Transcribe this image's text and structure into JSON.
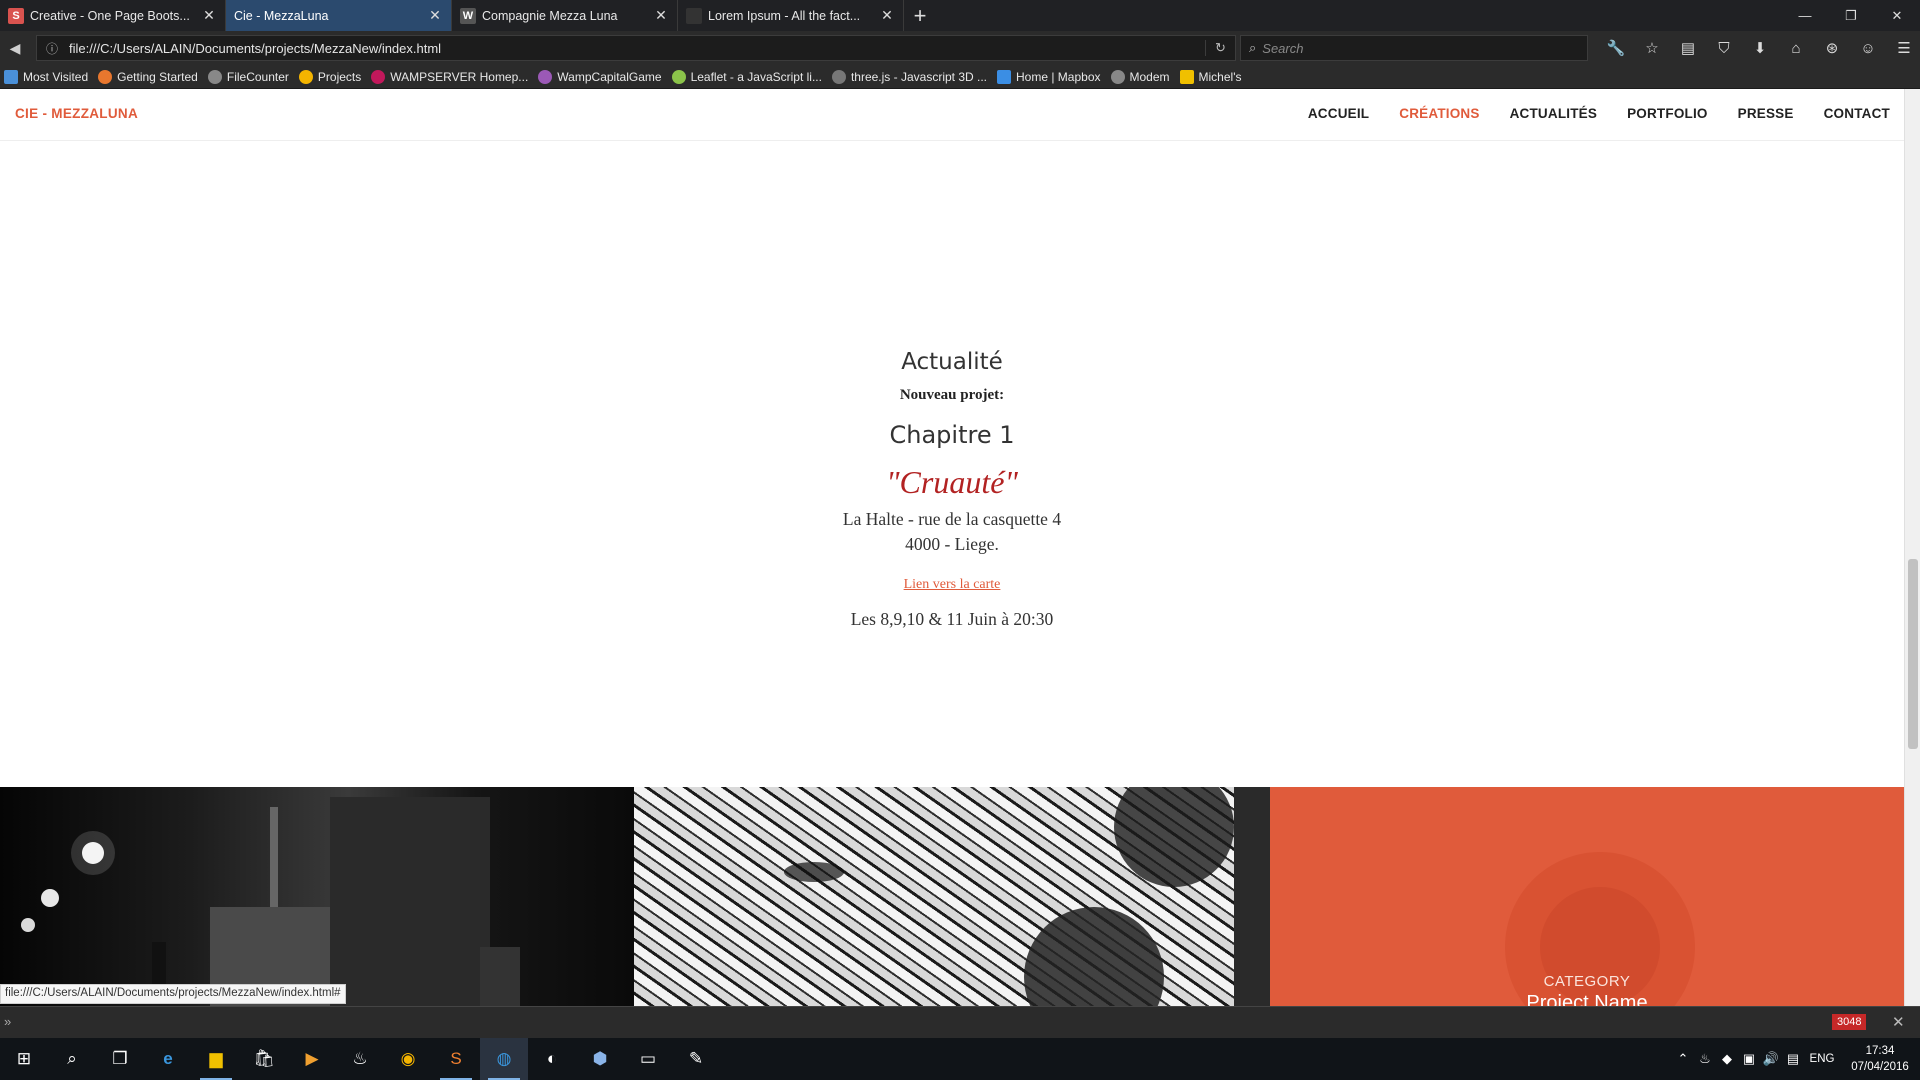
{
  "tabs": [
    {
      "title": "Creative - One Page Boots...",
      "favicon": "S",
      "favicon_color": "#d9534f"
    },
    {
      "title": "Cie - MezzaLuna",
      "favicon": "",
      "favicon_color": "#2b4a6e"
    },
    {
      "title": "Compagnie Mezza Luna",
      "favicon": "W",
      "favicon_color": "#555555"
    },
    {
      "title": "Lorem Ipsum - All the fact...",
      "favicon": "",
      "favicon_color": "#333333"
    }
  ],
  "address": {
    "url": "file:///C:/Users/ALAIN/Documents/projects/MezzaNew/index.html"
  },
  "search": {
    "placeholder": "Search"
  },
  "bookmarks": [
    {
      "label": "Most Visited",
      "color": "#4a90d9"
    },
    {
      "label": "Getting Started",
      "color": "#e8772e"
    },
    {
      "label": "FileCounter",
      "color": "#888888"
    },
    {
      "label": "Projects",
      "color": "#f4b400"
    },
    {
      "label": "WAMPSERVER Homep...",
      "color": "#c2185b"
    },
    {
      "label": "WampCapitalGame",
      "color": "#9b59b6"
    },
    {
      "label": "Leaflet - a JavaScript li...",
      "color": "#8bc34a"
    },
    {
      "label": "three.js - Javascript 3D ...",
      "color": "#777777"
    },
    {
      "label": "Home | Mapbox",
      "color": "#3b8ee4"
    },
    {
      "label": "Modem",
      "color": "#888888"
    },
    {
      "label": "Michel's",
      "color": "#f0c000"
    }
  ],
  "site": {
    "brand": "CIE - MEZZALUNA",
    "menu": [
      "ACCUEIL",
      "CRÉATIONS",
      "ACTUALITÉS",
      "PORTFOLIO",
      "PRESSE",
      "CONTACT"
    ],
    "active_menu": "CRÉATIONS",
    "accent": "#e05b3b"
  },
  "news": {
    "heading": "Actualité",
    "subheading": "Nouveau projet:",
    "chapter": "Chapitre 1",
    "show_title": "\"Cruauté\"",
    "address_line1": "La Halte - rue de la casquette 4",
    "address_line2": "4000 - Liege.",
    "map_link": "Lien vers la carte",
    "dates": "Les 8,9,10 & 11 Juin à 20:30"
  },
  "gallery": {
    "card3_category": "CATEGORY",
    "card3_project": "Project Name"
  },
  "status_text": "file:///C:/Users/ALAIN/Documents/projects/MezzaNew/index.html#",
  "console": {
    "error_count": "3048"
  },
  "taskbar": {
    "lang": "ENG",
    "time": "17:34",
    "date": "07/04/2016"
  }
}
